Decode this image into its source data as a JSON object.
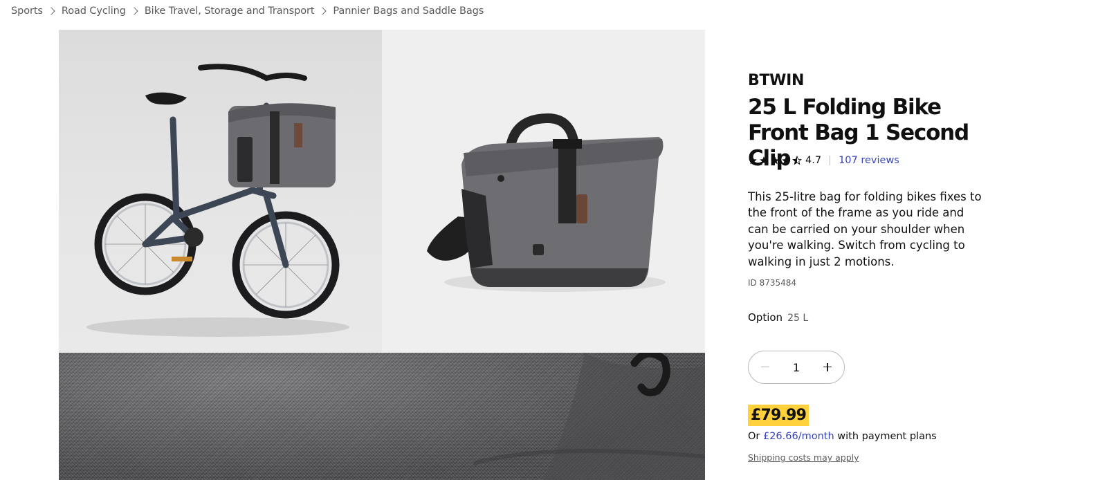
{
  "breadcrumb": [
    {
      "label": "Sports"
    },
    {
      "label": "Road Cycling"
    },
    {
      "label": "Bike Travel, Storage and Transport"
    },
    {
      "label": "Pannier Bags and Saddle Bags"
    }
  ],
  "gallery": {
    "images": [
      {
        "icon": "folding-bike-with-front-bag"
      },
      {
        "icon": "grey-front-bag"
      },
      {
        "icon": "fabric-close-up"
      }
    ]
  },
  "product": {
    "brand": "BTWIN",
    "title": "25 L Folding Bike Front Bag 1 Second Clip",
    "rating": {
      "value": "4.7",
      "stars": 4.5,
      "reviews_label": "107 reviews"
    },
    "description": "This 25-litre bag for folding bikes fixes to the front of the frame as you ride and can be carried on your shoulder when you're walking. Switch from cycling to walking in just 2 motions.",
    "id_label": "ID 8735484",
    "option": {
      "label": "Option",
      "value": "25 L"
    },
    "quantity": {
      "value": "1"
    },
    "price": "£79.99",
    "payment": {
      "prefix": "Or",
      "amount": "£26.66/month",
      "suffix": "with payment plans"
    },
    "shipping_note": "Shipping costs may apply"
  },
  "colors": {
    "accent_link": "#3643ba",
    "price_highlight": "#ffd13a",
    "text": "#101010",
    "muted": "#5a5a5a"
  }
}
